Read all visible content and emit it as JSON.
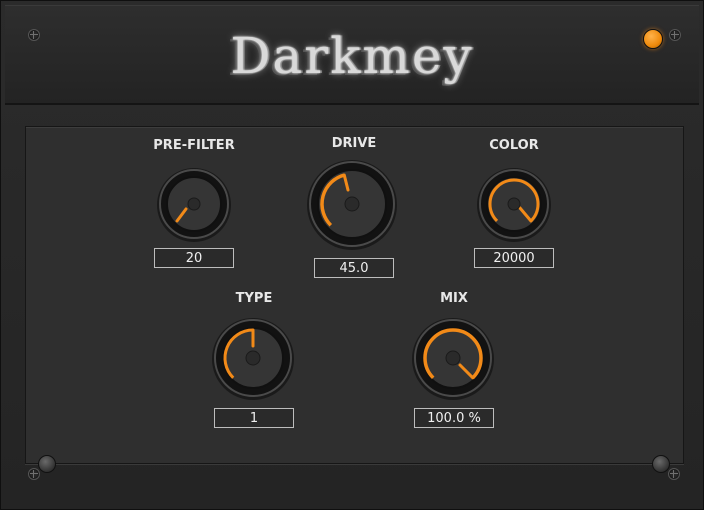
{
  "header": {
    "logo_text": "Darkmey"
  },
  "colors": {
    "accent": "#f28a18",
    "panel": "#2f2f2f",
    "header": "#2b2b2b"
  },
  "knobs": {
    "prefilter": {
      "label": "PRE-FILTER",
      "value": "20"
    },
    "drive": {
      "label": "DRIVE",
      "value": "45.0"
    },
    "color": {
      "label": "COLOR",
      "value": "20000"
    },
    "type": {
      "label": "TYPE",
      "value": "1"
    },
    "mix": {
      "label": "MIX",
      "value": "100.0 %"
    }
  }
}
